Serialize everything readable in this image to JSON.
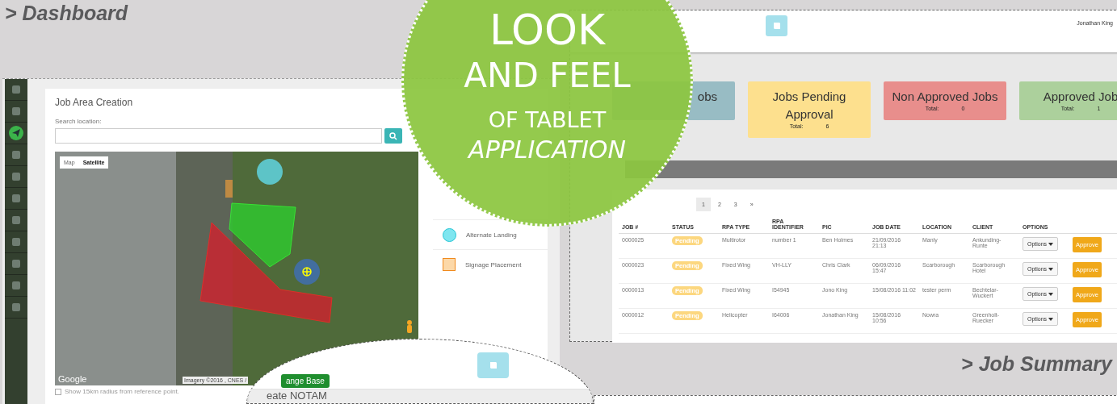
{
  "dashboard_caption": "> Dashboard",
  "job_summary_caption": "> Job Summary",
  "banner": {
    "lines": [
      "LOOK",
      "AND FEEL",
      "OF TABLET",
      "APPLICATION"
    ]
  },
  "sidebar": {
    "items": [
      {
        "selected": false
      },
      {
        "selected": false
      },
      {
        "selected": true
      },
      {
        "selected": false
      },
      {
        "selected": false
      },
      {
        "selected": false
      },
      {
        "selected": false
      },
      {
        "selected": false
      },
      {
        "selected": false
      },
      {
        "selected": false
      },
      {
        "selected": false
      }
    ]
  },
  "job_area": {
    "title": "Job Area Creation",
    "search_label": "Search location:",
    "map_tabs": [
      {
        "label": "Map",
        "selected": false
      },
      {
        "label": "Satellite",
        "selected": true
      }
    ],
    "map_logo": "Google",
    "map_attribution": "Imagery ©2016 , CNES /",
    "radius_checkbox": {
      "label": "Show 15km radius from reference point.",
      "checked": false
    },
    "legend": [
      {
        "kind": "circle",
        "label": "Alternate Landing",
        "color": "#7fe6f0"
      },
      {
        "kind": "square",
        "label": "Signage Placement",
        "color": "#fcd8a8"
      }
    ]
  },
  "summary": {
    "user": "Jonathan King",
    "cards": [
      {
        "title": "obs",
        "color": "#98bcc4"
      },
      {
        "title": "Jobs Pending Approval",
        "total_label": "Total:",
        "total": "6",
        "color": "#fde08e"
      },
      {
        "title": "Non Approved Jobs",
        "total_label": "Total:",
        "total": "0",
        "color": "#e88e8c"
      },
      {
        "title": "Approved Job",
        "total_label": "Total:",
        "total": "1",
        "color": "#acd09c"
      }
    ],
    "pages": [
      {
        "label": "1",
        "selected": true
      },
      {
        "label": "2",
        "selected": false
      },
      {
        "label": "3",
        "selected": false
      },
      {
        "label": "»",
        "selected": false
      }
    ],
    "columns": [
      "JOB #",
      "STATUS",
      "RPA TYPE",
      "RPA IDENTIFIER",
      "PIC",
      "JOB DATE",
      "LOCATION",
      "CLIENT",
      "OPTIONS"
    ],
    "rows": [
      {
        "job": "0000025",
        "status": "Pending",
        "rpa_type": "Multirotor",
        "rpa_identifier": "number 1",
        "pic": "Ben Holmes",
        "job_date": "21/09/2016 21:13",
        "location": "Manly",
        "client": "Ankunding-Runte",
        "options": "Options",
        "action": "Approve"
      },
      {
        "job": "0000023",
        "status": "Pending",
        "rpa_type": "Fixed Wing",
        "rpa_identifier": "VH-LLY",
        "pic": "Chris Clark",
        "job_date": "06/09/2016 15:47",
        "location": "Scarborough",
        "client": "Scarborough Hotel",
        "options": "Options",
        "action": "Approve"
      },
      {
        "job": "0000013",
        "status": "Pending",
        "rpa_type": "Fixed Wing",
        "rpa_identifier": "I54945",
        "pic": "Jono King",
        "job_date": "15/08/2016 11:02",
        "location": "tester perm",
        "client": "Bechtelar-Wuckert",
        "options": "Options",
        "action": "Approve"
      },
      {
        "job": "0000012",
        "status": "Pending",
        "rpa_type": "Helicopter",
        "rpa_identifier": "I64006",
        "pic": "Jonathan King",
        "job_date": "15/08/2016 10:56",
        "location": "Nowra",
        "client": "Greenholt-Ruecker",
        "options": "Options",
        "action": "Approve"
      }
    ]
  },
  "magnifier": {
    "button": "ange Base",
    "heading": "eate NOTAM"
  }
}
